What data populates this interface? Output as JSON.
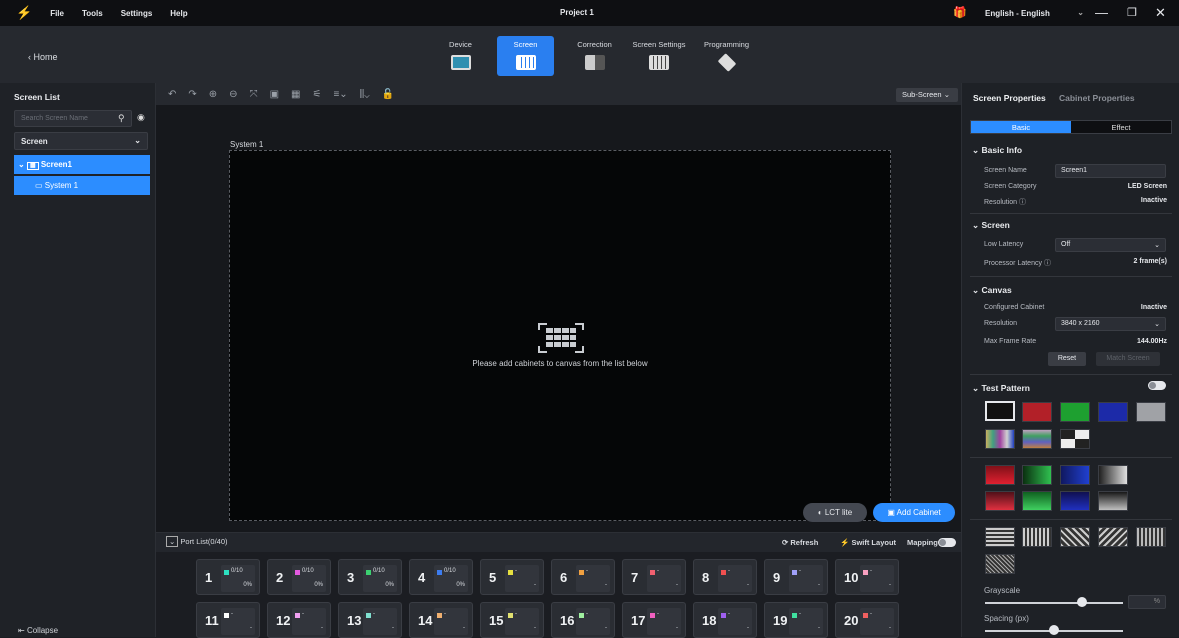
{
  "app": {
    "title": "Project 1",
    "menu": [
      "File",
      "Tools",
      "Settings",
      "Help"
    ],
    "language": "English - English"
  },
  "toolbar": {
    "home_label": "Home",
    "tabs": [
      {
        "label": "Device"
      },
      {
        "label": "Screen"
      },
      {
        "label": "Correction"
      },
      {
        "label": "Screen Settings"
      },
      {
        "label": "Programming"
      }
    ]
  },
  "sidebar": {
    "title": "Screen List",
    "search_placeholder": "Search Screen Name",
    "dropdown": "Screen",
    "tree": [
      {
        "label": "Screen1"
      },
      {
        "label": "System 1"
      }
    ],
    "collapse": "Collapse"
  },
  "canvas": {
    "subscreen": "Sub-Screen",
    "system_label": "System 1",
    "hint": "Please add cabinets to canvas from the list below",
    "lct_label": "LCT lite",
    "add_label": "Add Cabinet"
  },
  "ports": {
    "title": "Port List(0/40)",
    "refresh": "Refresh",
    "swift": "Swift Layout",
    "mapping": "Mapping",
    "row1": [
      {
        "n": "1",
        "c": "#2de0c0",
        "t1": "0/10",
        "t2": "0%"
      },
      {
        "n": "2",
        "c": "#e45ae0",
        "t1": "0/10",
        "t2": "0%"
      },
      {
        "n": "3",
        "c": "#3cd070",
        "t1": "0/10",
        "t2": "0%"
      },
      {
        "n": "4",
        "c": "#3c7cf0",
        "t1": "0/10",
        "t2": "0%"
      },
      {
        "n": "5",
        "c": "#e6e040",
        "t1": "-",
        "t2": "-"
      },
      {
        "n": "6",
        "c": "#f0a040",
        "t1": "-",
        "t2": "-"
      },
      {
        "n": "7",
        "c": "#f06070",
        "t1": "-",
        "t2": "-"
      },
      {
        "n": "8",
        "c": "#f05050",
        "t1": "-",
        "t2": "-"
      },
      {
        "n": "9",
        "c": "#a0a0f8",
        "t1": "-",
        "t2": "-"
      },
      {
        "n": "10",
        "c": "#f8a0c0",
        "t1": "-",
        "t2": "-"
      }
    ],
    "row2": [
      {
        "n": "11",
        "c": "#ffffff",
        "t1": "-",
        "t2": "-"
      },
      {
        "n": "12",
        "c": "#f0a0f0",
        "t1": "-",
        "t2": "-"
      },
      {
        "n": "13",
        "c": "#80e0d0",
        "t1": "-",
        "t2": "-"
      },
      {
        "n": "14",
        "c": "#f0b070",
        "t1": "-",
        "t2": "-"
      },
      {
        "n": "15",
        "c": "#e0e070",
        "t1": "-",
        "t2": "-"
      },
      {
        "n": "16",
        "c": "#a0f0a0",
        "t1": "-",
        "t2": "-"
      },
      {
        "n": "17",
        "c": "#f060c0",
        "t1": "-",
        "t2": "-"
      },
      {
        "n": "18",
        "c": "#a060f0",
        "t1": "-",
        "t2": "-"
      },
      {
        "n": "19",
        "c": "#40e0a0",
        "t1": "-",
        "t2": "-"
      },
      {
        "n": "20",
        "c": "#f06060",
        "t1": "-",
        "t2": "-"
      }
    ]
  },
  "rpanel": {
    "tab_screen": "Screen Properties",
    "tab_cabinet": "Cabinet Properties",
    "seg_basic": "Basic",
    "seg_effect": "Effect",
    "basic_info": "Basic Info",
    "screen_name_lbl": "Screen Name",
    "screen_name": "Screen1",
    "category_lbl": "Screen Category",
    "category": "LED Screen",
    "resolution_lbl": "Resolution",
    "resolution_state": "Inactive",
    "screen_sec": "Screen",
    "low_latency_lbl": "Low Latency",
    "low_latency": "Off",
    "proc_latency_lbl": "Processor Latency",
    "proc_latency": "2 frame(s)",
    "canvas_sec": "Canvas",
    "configured_lbl": "Configured Cabinet",
    "configured": "Inactive",
    "canvas_res_lbl": "Resolution",
    "canvas_res": "3840 x 2160",
    "max_fr_lbl": "Max Frame Rate",
    "max_fr": "144.00Hz",
    "reset": "Reset",
    "match": "Match Screen",
    "test_sec": "Test Pattern",
    "grayscale_lbl": "Grayscale",
    "grayscale_pct": "%",
    "spacing_lbl": "Spacing (px)",
    "grayscale_level": 0.7,
    "spacing_level": 0.5
  },
  "colors": {
    "accent": "#2c8dff"
  }
}
